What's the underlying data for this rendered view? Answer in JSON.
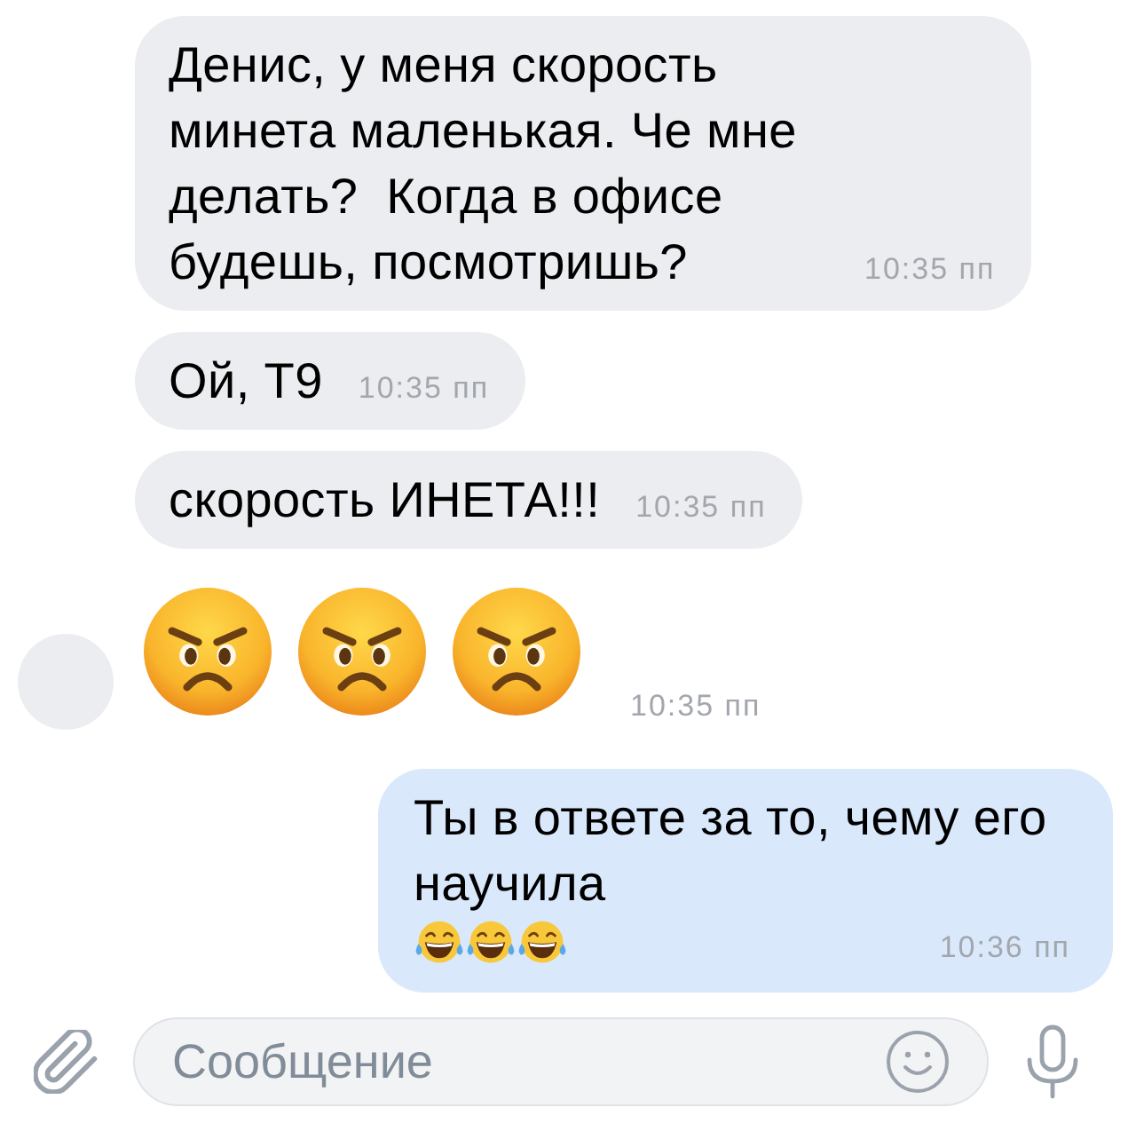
{
  "messages": [
    {
      "kind": "text",
      "outgoing": false,
      "avatar": false,
      "text": "Денис, у меня скорость минета маленькая. Че мне делать?  Когда в офисе будешь, посмотришь?",
      "time": "10:35 пп"
    },
    {
      "kind": "text",
      "outgoing": false,
      "avatar": false,
      "text": "Ой, Т9",
      "time": "10:35 пп"
    },
    {
      "kind": "text",
      "outgoing": false,
      "avatar": false,
      "text": "скорость ИНЕТА!!!",
      "time": "10:35 пп"
    },
    {
      "kind": "emoji",
      "outgoing": false,
      "avatar": true,
      "emojis": [
        {
          "kind": "angry"
        },
        {
          "kind": "angry"
        },
        {
          "kind": "angry"
        }
      ],
      "time": "10:35 пп"
    },
    {
      "kind": "text",
      "outgoing": true,
      "avatar": false,
      "text": "Ты в ответе за то, чему его научила",
      "emojis": [
        {
          "kind": "laughing"
        },
        {
          "kind": "laughing"
        },
        {
          "kind": "laughing"
        }
      ],
      "time": "10:36 пп"
    }
  ],
  "composer": {
    "placeholder": "Сообщение"
  }
}
